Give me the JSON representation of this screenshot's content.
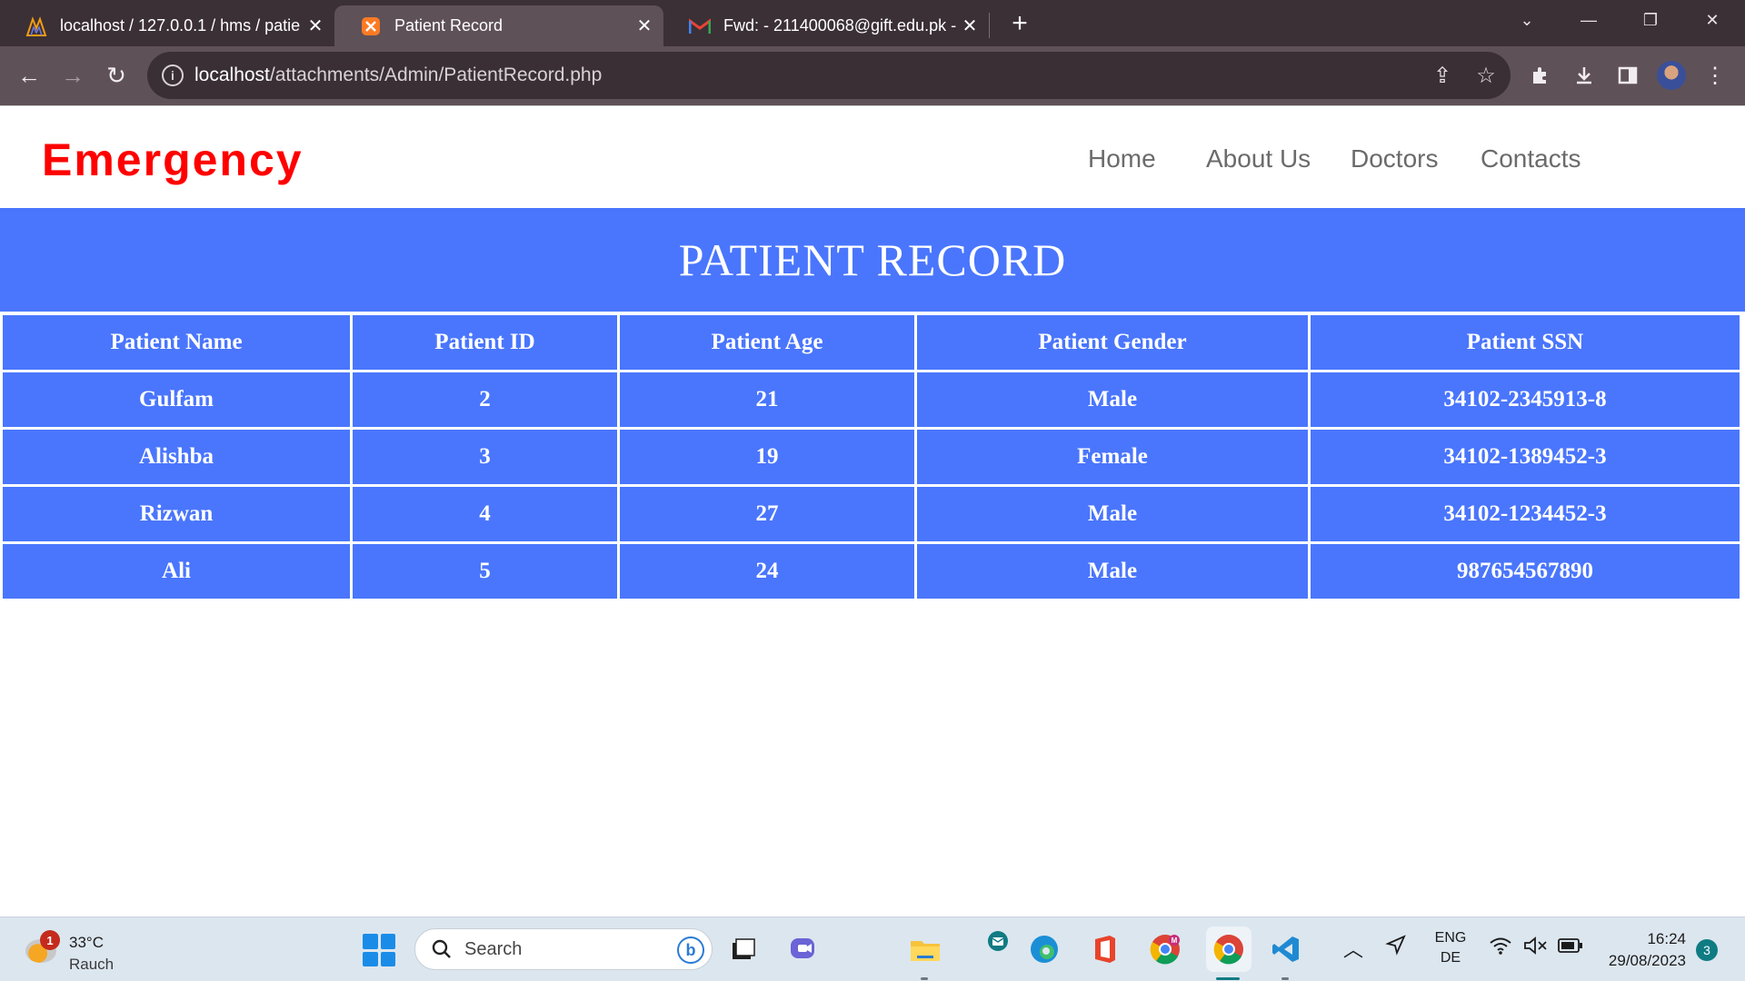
{
  "browser": {
    "tabs": [
      {
        "title": "localhost / 127.0.0.1 / hms / patie",
        "active": false,
        "icon": "phpmyadmin-icon"
      },
      {
        "title": "Patient Record",
        "active": true,
        "icon": "xampp-icon"
      },
      {
        "title": "Fwd: - 211400068@gift.edu.pk - ·",
        "active": false,
        "icon": "gmail-icon"
      }
    ],
    "new_tab_label": "+",
    "url_host": "localhost",
    "url_path": "/attachments/Admin/PatientRecord.php"
  },
  "site": {
    "brand": "Emergency",
    "nav": [
      "Home",
      "About Us",
      "Doctors",
      "Contacts"
    ],
    "banner_title": "PATIENT RECORD"
  },
  "table": {
    "headers": [
      "Patient Name",
      "Patient ID",
      "Patient Age",
      "Patient Gender",
      "Patient SSN"
    ],
    "rows": [
      [
        "Gulfam",
        "2",
        "21",
        "Male",
        "34102-2345913-8"
      ],
      [
        "Alishba",
        "3",
        "19",
        "Female",
        "34102-1389452-3"
      ],
      [
        "Rizwan",
        "4",
        "27",
        "Male",
        "34102-1234452-3"
      ],
      [
        "Ali",
        "5",
        "24",
        "Male",
        "987654567890"
      ]
    ]
  },
  "taskbar": {
    "weather_badge": "1",
    "temperature": "33°C",
    "condition": "Rauch",
    "search_placeholder": "Search",
    "language_top": "ENG",
    "language_bottom": "DE",
    "time": "16:24",
    "date": "29/08/2023",
    "notification_count": "3"
  },
  "colors": {
    "brand": "#ff0000",
    "accent_blue": "#4a76fd",
    "nav_text": "#6b6b6b"
  }
}
